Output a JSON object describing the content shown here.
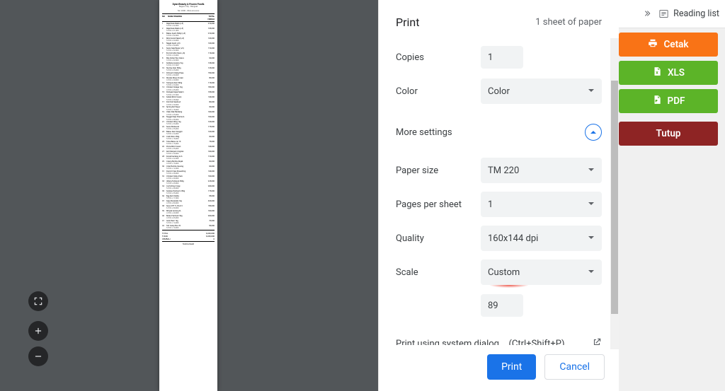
{
  "header": {
    "title": "Print",
    "sheet_info": "1 sheet of paper"
  },
  "settings": {
    "copies_label": "Copies",
    "copies_value": "1",
    "color_label": "Color",
    "color_value": "Color",
    "more_label": "More settings",
    "paper_label": "Paper size",
    "paper_value": "TM 220",
    "pps_label": "Pages per sheet",
    "pps_value": "1",
    "quality_label": "Quality",
    "quality_value": "160x144 dpi",
    "scale_label": "Scale",
    "scale_value": "Custom",
    "scale_number": "89",
    "system_label": "Print using system dialog...",
    "system_shortcut": "(Ctrl+Shift+P)"
  },
  "footer": {
    "print": "Print",
    "cancel": "Cancel"
  },
  "chrome": {
    "reading_list": "Reading list"
  },
  "app_buttons": {
    "cetak": "Cetak",
    "xls": "XLS",
    "pdf": "PDF",
    "tutup": "Tutup"
  },
  "receipt": {
    "store_name": "Dyan Beauty & Frozen Foods",
    "sub1": "Baguio City - Benguet",
    "sub2": "Tel: 2000 - 09xx-xxx-xxxx",
    "header_no": "NO",
    "header_item": "NAMA BARANG",
    "header_total": "TOTAL HARGA",
    "items": [
      {
        "n": "1",
        "name": "Raja Rasa Madu (+5)",
        "price": "210,000",
        "q": "5 PCS x 42,000"
      },
      {
        "n": "2",
        "name": "Raja Rasa Madu (+5)",
        "price": "105,000",
        "q": "5 PCS x 21,000"
      },
      {
        "n": "3",
        "name": "Bakso Ayam 500gr (+5)",
        "price": "210,000",
        "q": "5 PCS x 42,000"
      },
      {
        "n": "4",
        "name": "Mini Donat Paket (+5)",
        "price": "120,000",
        "q": "5 PCS x 24,000"
      },
      {
        "n": "5",
        "name": "Naget Ayam (+5)",
        "price": "120,000",
        "q": "4 PCS x 30,000"
      },
      {
        "n": "6",
        "name": "Sosis Sapi Besar (+5)",
        "price": "110,000",
        "q": "5 PCS x 22,000"
      },
      {
        "n": "7",
        "name": "Es Krim Mini Pack (+5)",
        "price": "115,000",
        "q": "5 PCS x 23,000"
      },
      {
        "n": "8",
        "name": "Mie Instan Box 24pcs",
        "price": "96,000",
        "q": "3 PCS x 32,000"
      },
      {
        "n": "9",
        "name": "Kentang Goreng 1kg",
        "price": "135,000",
        "q": "5 PCS x 27,000"
      },
      {
        "n": "10",
        "name": "Siomay Ikan 500g",
        "price": "125,000",
        "q": "5 PCS x 25,000"
      },
      {
        "n": "11",
        "name": "Dimsum Udang Hijau",
        "price": "150,000",
        "q": "5 PCS x 30,000"
      },
      {
        "n": "12",
        "name": "Risoles Mayo Frozen",
        "price": "80,000",
        "q": "4 PCS x 20,000"
      },
      {
        "n": "13",
        "name": "Tempura Ikan 500g",
        "price": "115,000",
        "q": "5 PCS x 23,000"
      },
      {
        "n": "14",
        "name": "Chicken Karage 1kg",
        "price": "180,000",
        "q": "4 PCS x 45,000"
      },
      {
        "n": "15",
        "name": "Pempek Kapal Selam",
        "price": "185,000",
        "q": "5 PCS x 37,000"
      },
      {
        "n": "16",
        "name": "Kebab Mini Frozen",
        "price": "140,000",
        "q": "5 PCS x 28,000"
      },
      {
        "n": "17",
        "name": "Fish Roll Seafood",
        "price": "80,000",
        "q": "4 PCS x 20,000"
      },
      {
        "n": "18",
        "name": "Spring Roll Sayur",
        "price": "90,000",
        "q": "5 PCS x 18,000"
      },
      {
        "n": "19",
        "name": "Otak-Otak Bandeng",
        "price": "100,000",
        "q": "4 PCS x 25,000"
      },
      {
        "n": "20",
        "name": "Nugget Sapi Premium",
        "price": "190,000",
        "q": "5 PCS x 38,000"
      },
      {
        "n": "21",
        "name": "Chicken Wing 1kg",
        "price": "165,000",
        "q": "5 PCS x 33,000"
      },
      {
        "n": "22",
        "name": "Sosis Bratwurst",
        "price": "175,000",
        "q": "5 PCS x 35,000"
      },
      {
        "n": "23",
        "name": "Bakso Ikan Tenggiri",
        "price": "120,000",
        "q": "5 PCS x 24,000"
      },
      {
        "n": "24",
        "name": "Crab Stick 250g",
        "price": "90,000",
        "q": "5 PCS x 18,000"
      },
      {
        "n": "25",
        "name": "Tahu Bakso Isi 10",
        "price": "75,000",
        "q": "5 PCS x 15,000"
      },
      {
        "n": "26",
        "name": "Pizza Mini Frozen",
        "price": "140,000",
        "q": "4 PCS x 35,000"
      },
      {
        "n": "27",
        "name": "Roti Maryam Original",
        "price": "100,000",
        "q": "5 PCS x 20,000"
      },
      {
        "n": "28",
        "name": "Donat Kentang Isi 6",
        "price": "110,000",
        "q": "5 PCS x 22,000"
      },
      {
        "n": "29",
        "name": "Cireng Bumbu Rujak",
        "price": "60,000",
        "q": "4 PCS x 15,000"
      },
      {
        "n": "30",
        "name": "Cilok Bumbu Kacang",
        "price": "60,000",
        "q": "5 PCS x 12,000"
      },
      {
        "n": "31",
        "name": "French Fries Shoestring",
        "price": "140,000",
        "q": "5 PCS x 28,000"
      },
      {
        "n": "32",
        "name": "Chicken Katsu Pack",
        "price": "160,000",
        "q": "4 PCS x 40,000"
      },
      {
        "n": "33",
        "name": "Udang Tempura 500g",
        "price": "225,000",
        "q": "5 PCS x 45,000"
      },
      {
        "n": "34",
        "name": "Cumi Ring Crispy",
        "price": "200,000",
        "q": "5 PCS x 40,000"
      },
      {
        "n": "35",
        "name": "Scallop Premium 250g",
        "price": "175,000",
        "q": "5 PCS x 35,000"
      },
      {
        "n": "36",
        "name": "Egg Roll Vanilla",
        "price": "85,000",
        "q": "5 PCS x 17,000"
      },
      {
        "n": "37",
        "name": "Keju Mozarella 1kg",
        "price": "320,000",
        "q": "4 PCS x 80,000"
      },
      {
        "n": "38",
        "name": "Susu UHT 1L Box12",
        "price": "180,000",
        "q": "6 PCS x 30,000"
      },
      {
        "n": "39",
        "name": "Minyak Goreng 2L",
        "price": "160,000",
        "q": "4 PCS x 40,000"
      },
      {
        "n": "40",
        "name": "Beras Premium 5kg",
        "price": "260,000",
        "q": "4 PCS x 65,000"
      },
      {
        "n": "41",
        "name": "Gula Pasir 1kg",
        "price": "70,000",
        "q": "5 PCS x 14,000"
      },
      {
        "n": "42",
        "name": "Teh Celup Box 25",
        "price": "50,000",
        "q": "5 PCS x 10,000"
      }
    ],
    "total_label": "TOTAL",
    "total_value": "6,040,000",
    "tunai_label": "TUNAI",
    "tunai_value": "6,040,000",
    "kembali_label": "KEMBALI",
    "kembali_value": "0",
    "thanks": "Terima Kasih"
  }
}
